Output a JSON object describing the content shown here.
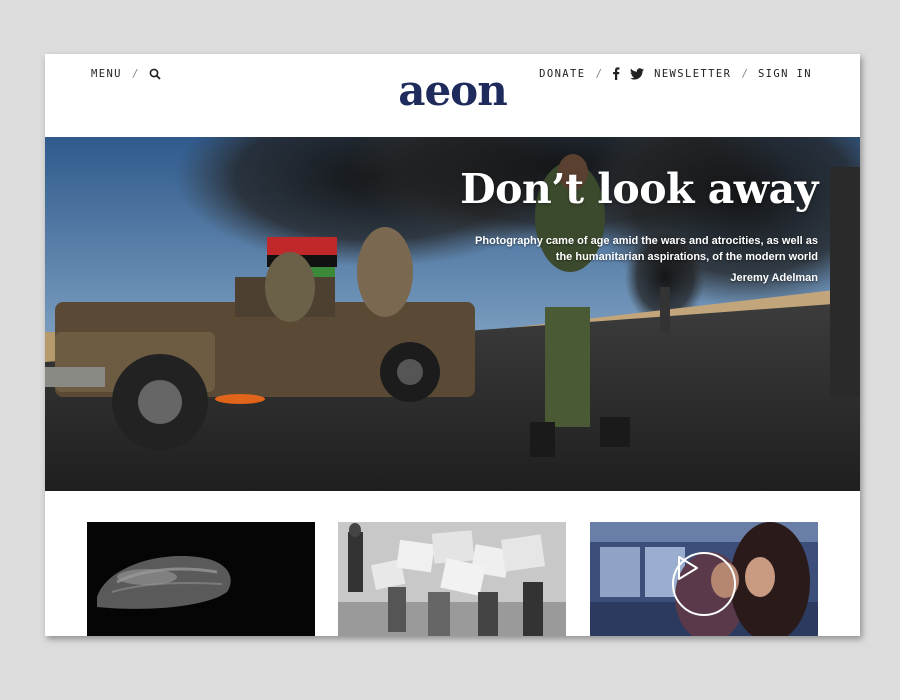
{
  "header": {
    "menu_label": "MENU",
    "separator": "/",
    "logo_text": "aeon",
    "donate_label": "DONATE",
    "newsletter_label": "NEWSLETTER",
    "signin_label": "SIGN IN",
    "icons": [
      "search-icon",
      "facebook-icon",
      "twitter-icon"
    ]
  },
  "hero": {
    "title": "Don’t look away",
    "subtitle": "Photography came of age amid the wars and atrocities, as well as the humanitarian aspirations, of the modern world",
    "author": "Jeremy Adelman"
  },
  "cards": [
    {
      "image": "hand-in-darkness-photo"
    },
    {
      "image": "crowd-carrying-boxes-photo"
    },
    {
      "image": "video-still-photo",
      "icon": "play-icon"
    }
  ],
  "colors": {
    "logo": "#1e2b5c",
    "background": "#dcdcdc",
    "page": "#ffffff"
  }
}
